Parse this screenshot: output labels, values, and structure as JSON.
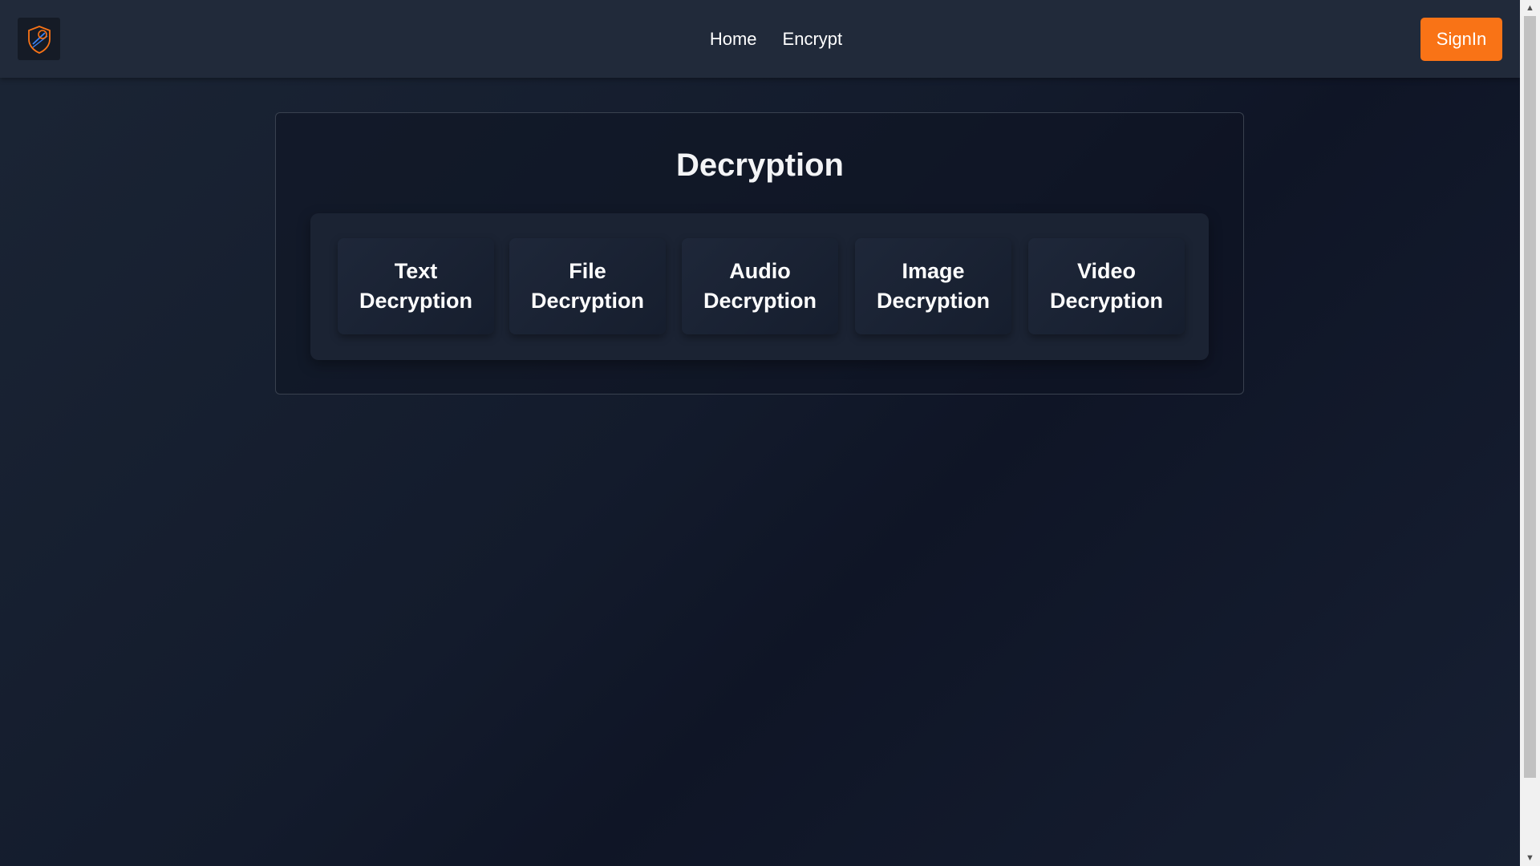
{
  "nav": {
    "logo_icon": "shield-logo-icon",
    "links": [
      {
        "label": "Home"
      },
      {
        "label": "Encrypt"
      }
    ],
    "signin_label": "SignIn"
  },
  "main": {
    "title": "Decryption",
    "options": [
      {
        "label": "Text\nDecryption"
      },
      {
        "label": "File\nDecryption"
      },
      {
        "label": "Audio\nDecryption"
      },
      {
        "label": "Image\nDecryption"
      },
      {
        "label": "Video\nDecryption"
      }
    ]
  },
  "colors": {
    "accent": "#f97316",
    "navbar": "#212a3a",
    "background": "#131b2c"
  }
}
